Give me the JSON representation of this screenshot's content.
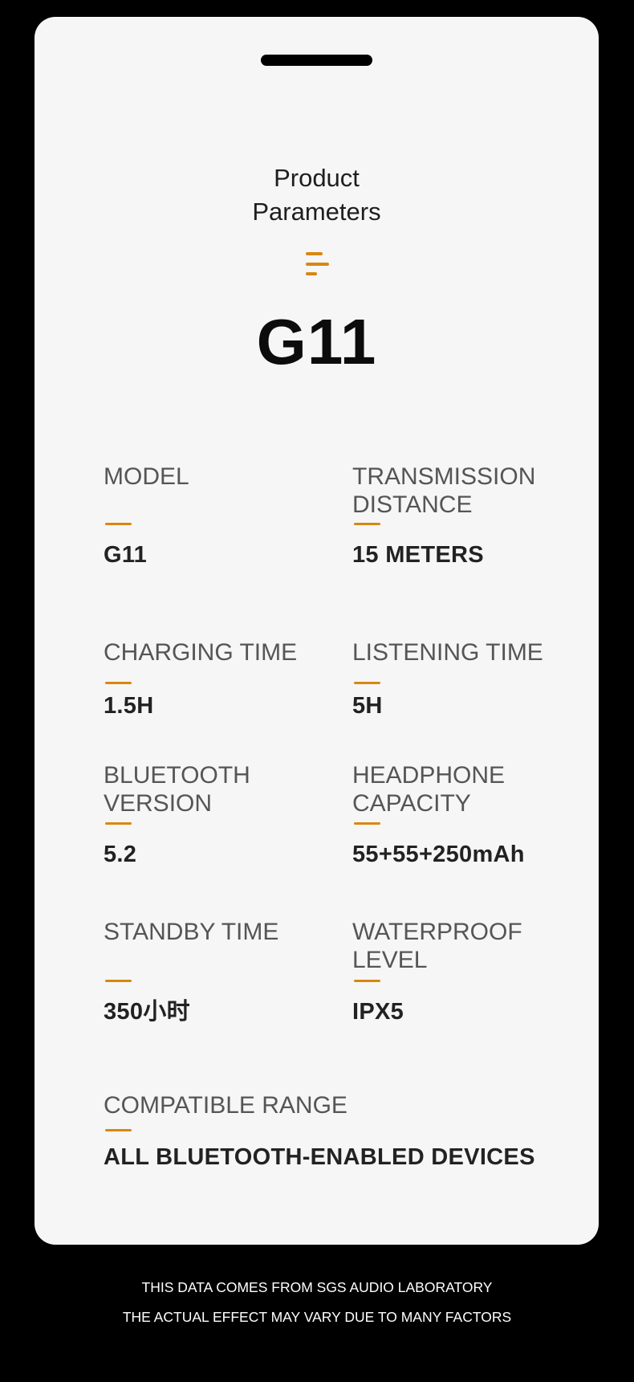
{
  "header": {
    "title_line1": "Product",
    "title_line2": "Parameters",
    "icon": "menu-lines-icon",
    "model_name": "G11"
  },
  "accent_color": "#d9870f",
  "parameters": [
    {
      "label": "MODEL",
      "value": "G11"
    },
    {
      "label": "TRANSMISSION DISTANCE",
      "value": "15 METERS"
    },
    {
      "label": "CHARGING TIME",
      "value": "1.5H"
    },
    {
      "label": "LISTENING TIME",
      "value": "5H"
    },
    {
      "label": "BLUETOOTH VERSION",
      "value": "5.2"
    },
    {
      "label": "HEADPHONE CAPACITY",
      "value": "55+55+250mAh"
    },
    {
      "label": "STANDBY TIME",
      "value": "350小时"
    },
    {
      "label": "WATERPROOF LEVEL",
      "value": "IPX5"
    },
    {
      "label": "COMPATIBLE RANGE",
      "value": "ALL BLUETOOTH-ENABLED DEVICES"
    }
  ],
  "footer": {
    "line1": "THIS DATA COMES FROM SGS AUDIO LABORATORY",
    "line2": "THE ACTUAL EFFECT MAY VARY DUE TO MANY FACTORS"
  }
}
